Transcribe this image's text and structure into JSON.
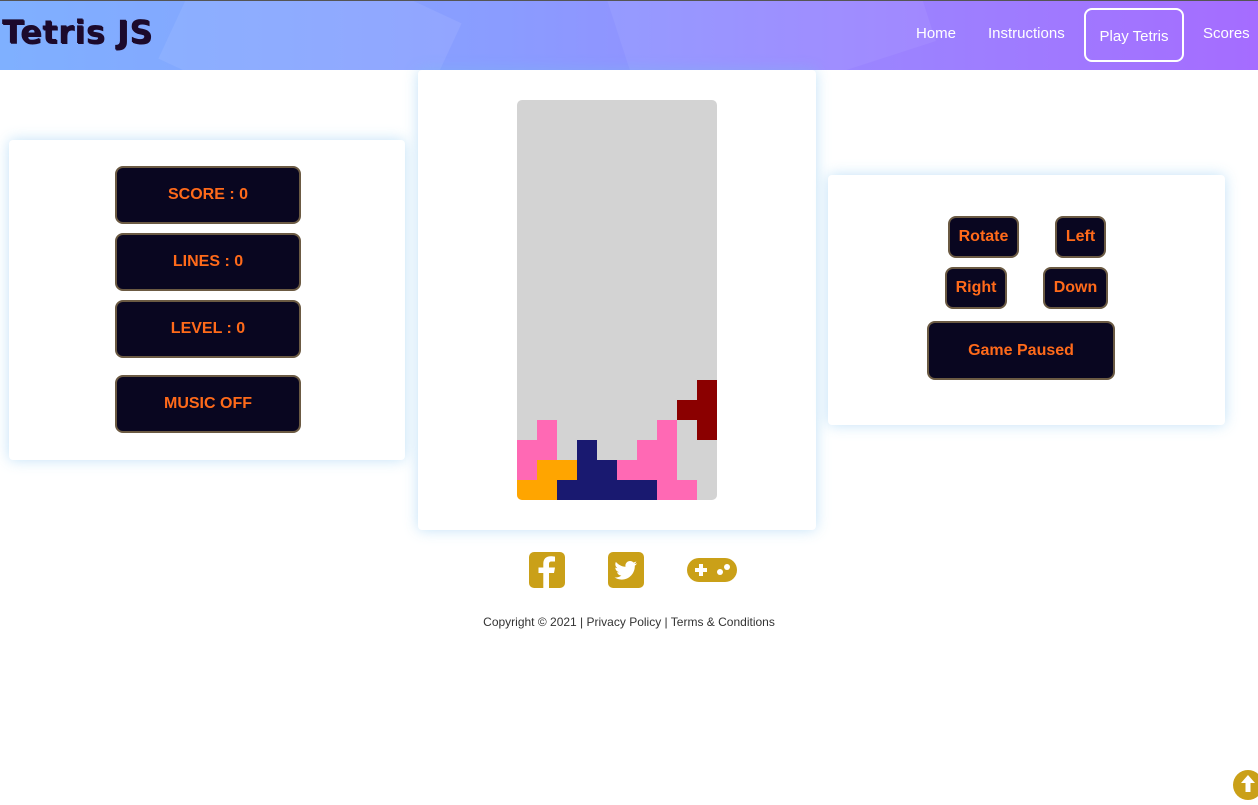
{
  "header": {
    "brand": "Tetris JS",
    "nav": [
      "Home",
      "Instructions",
      "Play Tetris",
      "Scores"
    ],
    "active": "Play Tetris"
  },
  "stats": {
    "score": "SCORE : 0",
    "lines": "LINES : 0",
    "level": "LEVEL : 0",
    "music": "MUSIC OFF"
  },
  "controls": {
    "rotate": "Rotate",
    "left": "Left",
    "right": "Right",
    "down": "Down",
    "pause": "Game Paused"
  },
  "board": {
    "columns": 10,
    "rows": 20,
    "colors": {
      "P": "#ff69b4",
      "O": "#ffa500",
      "N": "#191970",
      "R": "#8b0000"
    },
    "grid": [
      "..........",
      "..........",
      "..........",
      "..........",
      "..........",
      "..........",
      "..........",
      "..........",
      "..........",
      "..........",
      "..........",
      "..........",
      "..........",
      "..........",
      ".........R",
      "........RR",
      ".P.....P.R",
      "PP.N..PP..",
      "POONNPPP..",
      "OONNNNNPP."
    ]
  },
  "social": [
    "facebook-icon",
    "twitter-icon",
    "gamepad-icon"
  ],
  "footer": {
    "copyright": "Copyright © 2021 |",
    "privacy": "Privacy Policy",
    "sep": "|",
    "terms": "Terms & Conditions"
  },
  "accent": "#caa018"
}
